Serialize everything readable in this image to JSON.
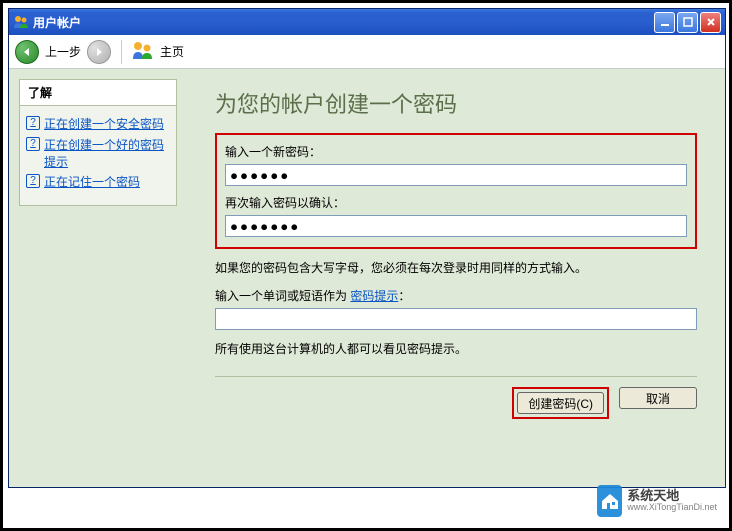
{
  "window": {
    "title": "用户帐户"
  },
  "toolbar": {
    "back_label": "上一步",
    "home_label": "主页"
  },
  "sidebar": {
    "panel_title": "了解",
    "items": [
      {
        "label": "正在创建一个安全密码"
      },
      {
        "label": "正在创建一个好的密码提示"
      },
      {
        "label": "正在记住一个密码"
      }
    ]
  },
  "content": {
    "title": "为您的帐户创建一个密码",
    "new_pw_label": "输入一个新密码：",
    "new_pw_value": "●●●●●●",
    "confirm_pw_label": "再次输入密码以确认：",
    "confirm_pw_value": "●●●●●●●",
    "caps_note": "如果您的密码包含大写字母，您必须在每次登录时用同样的方式输入。",
    "hint_label_prefix": "输入一个单词或短语作为 ",
    "hint_link": "密码提示",
    "hint_label_suffix": "：",
    "hint_value": "",
    "hint_note": "所有使用这台计算机的人都可以看见密码提示。",
    "create_button": "创建密码(C)",
    "cancel_button": "取消"
  },
  "watermark": {
    "title": "系统天地",
    "url": "www.XiTongTianDi.net"
  }
}
